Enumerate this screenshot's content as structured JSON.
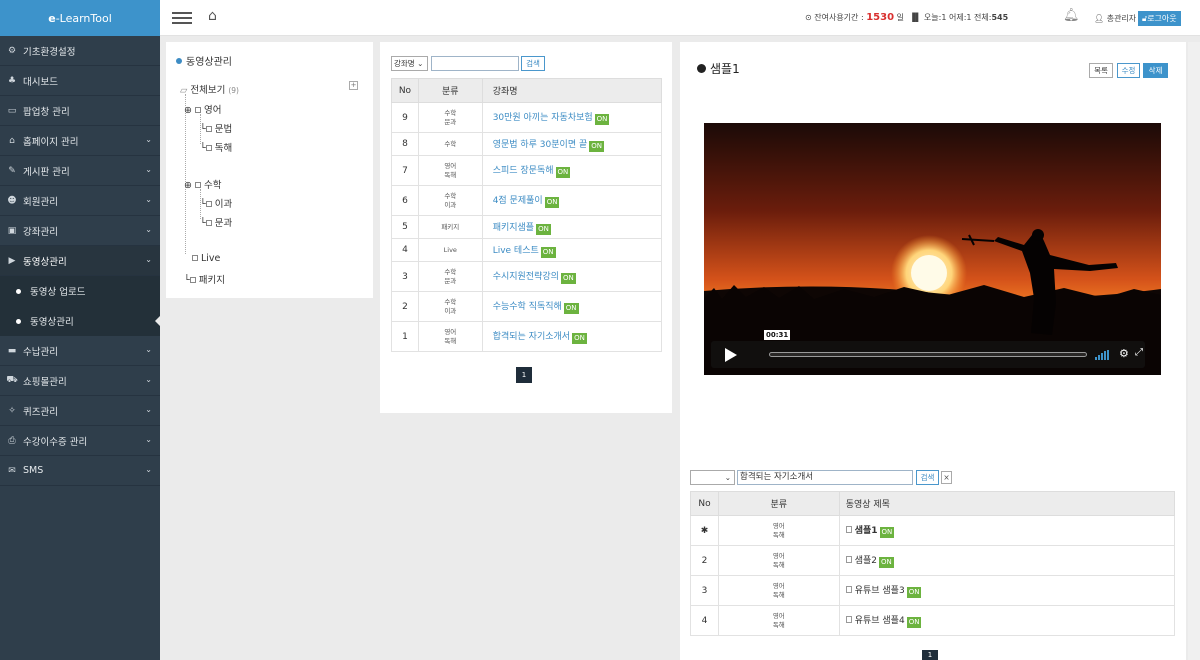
{
  "brand": {
    "prefix": "e",
    "name": "-LearnTool"
  },
  "sidebar": {
    "items": [
      {
        "icon": "⚙",
        "label": "기초환경설정",
        "chev": ""
      },
      {
        "icon": "♣",
        "label": "대시보드",
        "chev": ""
      },
      {
        "icon": "▭",
        "label": "팝업창 관리",
        "chev": ""
      },
      {
        "icon": "⌂",
        "label": "홈페이지 관리",
        "chev": "⌄"
      },
      {
        "icon": "✎",
        "label": "게시판 관리",
        "chev": "⌄"
      },
      {
        "icon": "☻",
        "label": "회원관리",
        "chev": "⌄"
      },
      {
        "icon": "▣",
        "label": "강좌관리",
        "chev": "⌄"
      },
      {
        "icon": "▶",
        "label": "동영상관리",
        "chev": "⌄"
      },
      {
        "icon": "▬",
        "label": "수납관리",
        "chev": "⌄"
      },
      {
        "icon": "⛟",
        "label": "쇼핑몰관리",
        "chev": "⌄"
      },
      {
        "icon": "✧",
        "label": "퀴즈관리",
        "chev": "⌄"
      },
      {
        "icon": "⎙",
        "label": "수강이수증 관리",
        "chev": "⌄"
      },
      {
        "icon": "✉",
        "label": "SMS",
        "chev": "⌄"
      }
    ],
    "subitems": [
      "동영상 업로드",
      "동영상관리"
    ]
  },
  "header": {
    "period_label": "⊙ 잔여사용기간 :",
    "period_value": "1530",
    "period_unit": "일",
    "stats": "오늘:1  어제:1  전체:",
    "total": "545",
    "user": "총관리자",
    "logout": "로그아웃"
  },
  "tree": {
    "title": "동영상관리",
    "root": "전체보기",
    "root_count": "(9)",
    "eng": "영어",
    "grammar": "문법",
    "reading": "독해",
    "math": "수학",
    "science": "이과",
    "liberal": "문과",
    "live": "Live",
    "package": "패키지"
  },
  "lecture": {
    "select": "강좌명",
    "search": "",
    "search_btn": "검색",
    "headers": [
      "No",
      "분류",
      "강좌명"
    ],
    "rows": [
      {
        "no": "9",
        "cat1": "수학",
        "cat2": "문과",
        "title": "30만원 아끼는 자동차보험"
      },
      {
        "no": "8",
        "cat1": "수학",
        "cat2": "",
        "title": "영문법 하루 30분이면 끝"
      },
      {
        "no": "7",
        "cat1": "영어",
        "cat2": "독해",
        "title": "스피드 장문독해"
      },
      {
        "no": "6",
        "cat1": "수학",
        "cat2": "이과",
        "title": "4점 문제풀이"
      },
      {
        "no": "5",
        "cat1": "패키지",
        "cat2": "",
        "title": "패키지샘플"
      },
      {
        "no": "4",
        "cat1": "Live",
        "cat2": "",
        "title": "Live 테스트"
      },
      {
        "no": "3",
        "cat1": "수학",
        "cat2": "문과",
        "title": "수시지원전략강의"
      },
      {
        "no": "2",
        "cat1": "수학",
        "cat2": "이과",
        "title": "수능수학 직독직해"
      },
      {
        "no": "1",
        "cat1": "영어",
        "cat2": "독해",
        "title": "합격되는 자기소개서"
      }
    ],
    "on": "ON",
    "page": "1"
  },
  "detail": {
    "title": "샘플1",
    "btn_list": "목록",
    "btn_edit": "수정",
    "btn_delete": "삭제",
    "time": "00:31",
    "search_value": "합격되는 자기소개서",
    "search_btn": "검색",
    "clear": "×",
    "headers": [
      "No",
      "분류",
      "동영상 제목"
    ],
    "rows": [
      {
        "no": "✱",
        "cat1": "영어",
        "cat2": "독해",
        "title": "샘플1",
        "bold": true
      },
      {
        "no": "2",
        "cat1": "영어",
        "cat2": "독해",
        "title": "샘플2",
        "bold": false
      },
      {
        "no": "3",
        "cat1": "영어",
        "cat2": "독해",
        "title": "유튜브 샘플3",
        "bold": false
      },
      {
        "no": "4",
        "cat1": "영어",
        "cat2": "독해",
        "title": "유튜브 샘플4",
        "bold": false
      }
    ],
    "on": "ON",
    "page": "1"
  },
  "colors": {
    "brand": "#3d93cb",
    "sidebar": "#2f3e4b",
    "link": "#3d8cc4",
    "on_badge": "#6cb33f",
    "period": "#d9302f"
  }
}
